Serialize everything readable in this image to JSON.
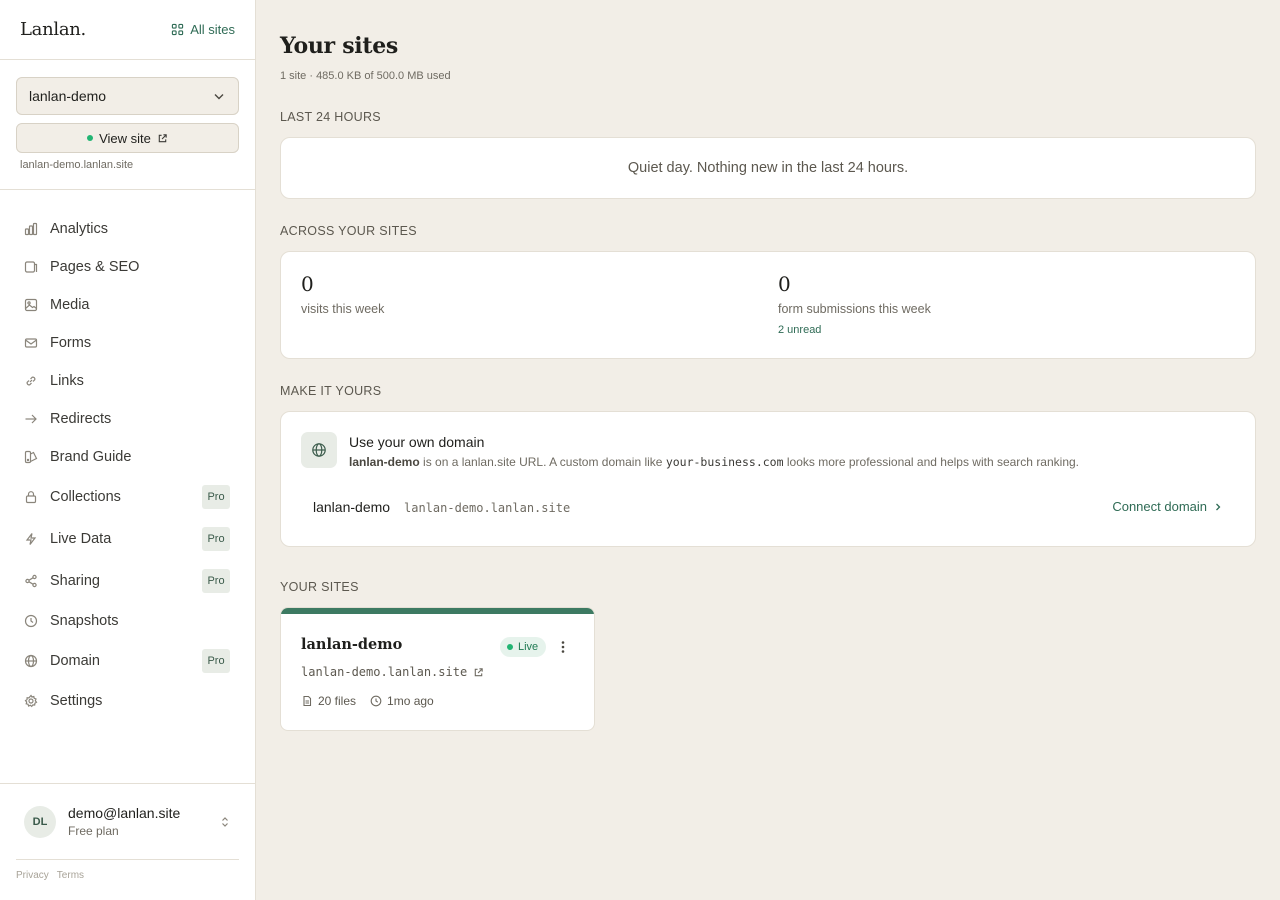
{
  "app": {
    "logo": "Lanlan.",
    "all_sites_label": "All sites"
  },
  "site_switcher": {
    "selected_site": "lanlan-demo",
    "view_site_label": "View site",
    "site_url": "lanlan-demo.lanlan.site"
  },
  "sidebar": {
    "items": [
      {
        "label": "Analytics",
        "icon": "bar-chart-icon",
        "badge": ""
      },
      {
        "label": "Pages & SEO",
        "icon": "page-icon",
        "badge": ""
      },
      {
        "label": "Media",
        "icon": "image-icon",
        "badge": ""
      },
      {
        "label": "Forms",
        "icon": "mail-icon",
        "badge": ""
      },
      {
        "label": "Links",
        "icon": "link-icon",
        "badge": ""
      },
      {
        "label": "Redirects",
        "icon": "arrow-right-icon",
        "badge": ""
      },
      {
        "label": "Brand Guide",
        "icon": "palette-icon",
        "badge": ""
      },
      {
        "label": "Collections",
        "icon": "lock-icon",
        "badge": "Pro"
      },
      {
        "label": "Live Data",
        "icon": "lightning-icon",
        "badge": "Pro"
      },
      {
        "label": "Sharing",
        "icon": "share-icon",
        "badge": "Pro"
      },
      {
        "label": "Snapshots",
        "icon": "clock-icon",
        "badge": ""
      },
      {
        "label": "Domain",
        "icon": "globe-icon",
        "badge": "Pro"
      },
      {
        "label": "Settings",
        "icon": "gear-icon",
        "badge": ""
      }
    ]
  },
  "user": {
    "initials": "DL",
    "email": "demo@lanlan.site",
    "plan": "Free plan"
  },
  "footer": {
    "privacy": "Privacy",
    "terms": "Terms"
  },
  "main": {
    "title": "Your sites",
    "subtitle": "1 site · 485.0 KB of 500.0 MB used",
    "last24": {
      "label": "LAST 24 HOURS",
      "message": "Quiet day. Nothing new in the last 24 hours."
    },
    "across": {
      "label": "ACROSS YOUR SITES",
      "visits_value": "0",
      "visits_label": "visits this week",
      "forms_value": "0",
      "forms_label": "form submissions this week",
      "unread": "2 unread"
    },
    "make_it_yours": {
      "label": "MAKE IT YOURS",
      "title": "Use your own domain",
      "desc_site": "lanlan-demo",
      "desc_mid": " is on a lanlan.site URL. A custom domain like ",
      "desc_example": "your-business.com",
      "desc_end": " looks more professional and helps with search ranking.",
      "row_name": "lanlan-demo",
      "row_url": "lanlan-demo.lanlan.site",
      "connect_label": "Connect domain"
    },
    "your_sites": {
      "label": "YOUR SITES",
      "site": {
        "name": "lanlan-demo",
        "status": "Live",
        "url": "lanlan-demo.lanlan.site",
        "files": "20 files",
        "updated": "1mo ago"
      }
    }
  },
  "colors": {
    "accent": "#2f6b55",
    "live": "#22b573",
    "background": "#f2eee7",
    "card_bar": "#3d7a62"
  }
}
